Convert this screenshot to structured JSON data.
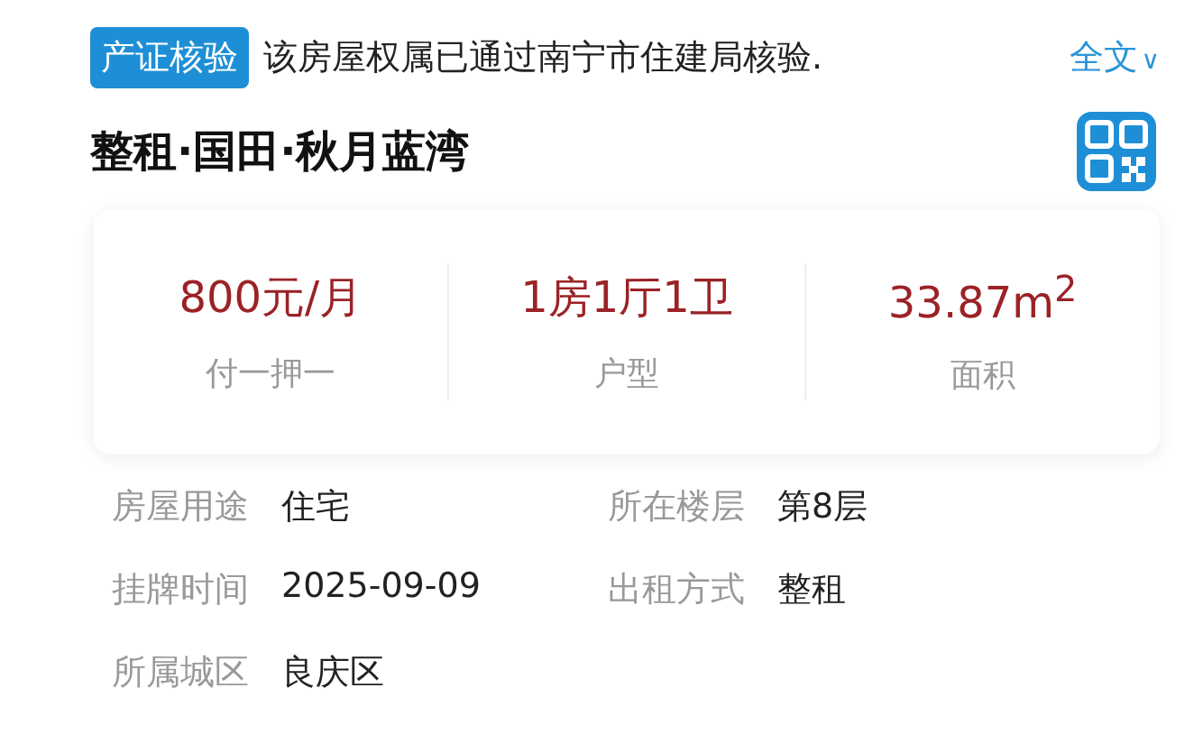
{
  "verification": {
    "badge": "产证核验",
    "message": "该房屋权属已通过南宁市住建局核验.",
    "link": "全文",
    "link_caret": "∨"
  },
  "title": "整租·国田·秋月蓝湾",
  "summary": [
    {
      "value": "800元/月",
      "label": "付一押一"
    },
    {
      "value": "1房1厅1卫",
      "label": "户型"
    },
    {
      "value": "33.87m$^{2}$",
      "label": "面积"
    }
  ],
  "details": [
    [
      {
        "label": "房屋用途",
        "value": "住宅"
      },
      {
        "label": "所在楼层",
        "value": "第8层"
      }
    ],
    [
      {
        "label": "挂牌时间",
        "value": "2025-09-09"
      },
      {
        "label": "出租方式",
        "value": "整租"
      }
    ],
    [
      {
        "label": "所属城区",
        "value": "良庆区"
      }
    ]
  ]
}
